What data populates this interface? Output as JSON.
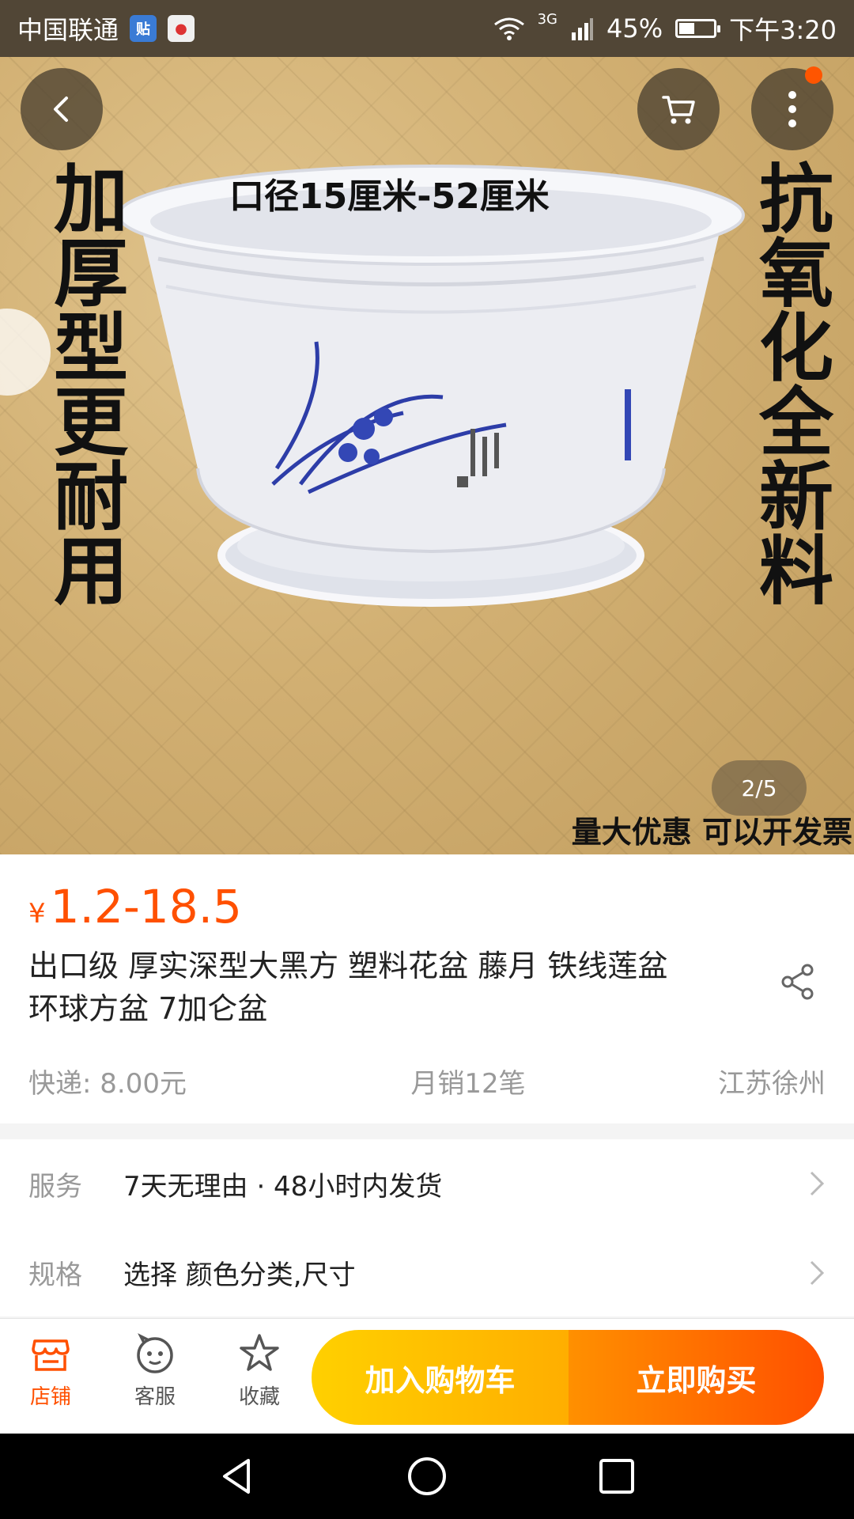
{
  "status_bar": {
    "carrier": "中国联通",
    "signal_type": "3G",
    "battery_percent": "45%",
    "battery_level": 0.45,
    "time": "下午3:20"
  },
  "hero": {
    "image_counter": "2/5",
    "image_text": {
      "top": "口径15厘米-52厘米",
      "left": "加厚型更耐用",
      "right": "抗氧化全新料",
      "bottom": "量大优惠 可以开发票"
    }
  },
  "product": {
    "currency": "¥",
    "price": "1.2-18.5",
    "title": "出口级 厚实深型大黑方 塑料花盆 藤月 铁线莲盆环球方盆 7加仑盆",
    "shipping": "快递: 8.00元",
    "monthly_sales": "月销12笔",
    "location": "江苏徐州"
  },
  "rows": {
    "service_label": "服务",
    "service_value": "7天无理由 · 48小时内发货",
    "spec_label": "规格",
    "spec_value": "选择 颜色分类,尺寸"
  },
  "actions": {
    "store": "店铺",
    "service": "客服",
    "favorite": "收藏",
    "add_to_cart": "加入购物车",
    "buy_now": "立即购买"
  },
  "colors": {
    "accent": "#ff5000",
    "cart_button": "#ffc000",
    "status_bar": "#514636"
  }
}
